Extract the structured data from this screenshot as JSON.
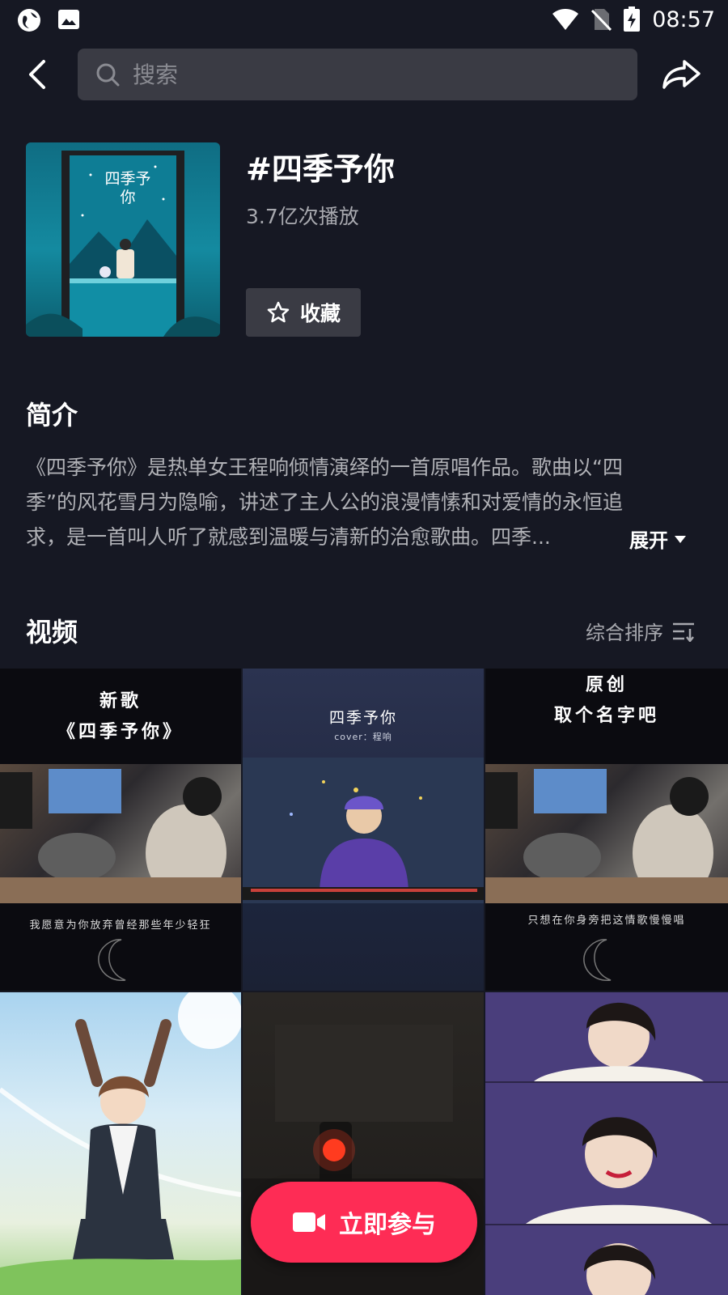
{
  "status_bar": {
    "time": "08:57",
    "left_icons": [
      "browser-globe-icon",
      "gallery-icon"
    ],
    "right_icons": [
      "wifi-icon",
      "no-sim-icon",
      "battery-charging-icon"
    ]
  },
  "top_bar": {
    "search_placeholder": "搜索",
    "back_icon": "back-arrow-icon",
    "share_icon": "share-icon"
  },
  "topic": {
    "title": "#四季予你",
    "plays": "3.7亿次播放",
    "favorite_label": "收藏",
    "cover_text": "四季予你"
  },
  "intro": {
    "heading": "简介",
    "lines": [
      "《四季予你》是热单女王程响倾情演绎的一首原唱作品。歌曲以“四",
      "季”的风花雪月为隐喻，讲述了主人公的浪漫情愫和对爱情的永恒追",
      "求，是一首叫人听了就感到温暖与清新的治愈歌曲。四季..."
    ],
    "expand_label": "展开"
  },
  "videos": {
    "heading": "视频",
    "sort_label": "综合排序",
    "tiles": [
      {
        "line1": "新歌",
        "line2": "《四季予你》",
        "subtitle": "我愿意为你放弃曾经那些年少轻狂"
      },
      {
        "line1": "四季予你",
        "line2": "cover：程响"
      },
      {
        "line1": "原创",
        "line2": "取个名字吧",
        "subtitle": "只想在你身旁把这情歌慢慢唱"
      },
      {},
      {},
      {}
    ]
  },
  "join_button": {
    "label": "立即参与"
  },
  "colors": {
    "background": "#161823",
    "surface": "#3a3b44",
    "accent": "#fe2c55",
    "secondary_text": "#a7a8ae"
  }
}
